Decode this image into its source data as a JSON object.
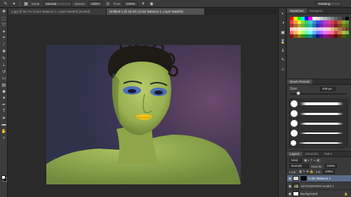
{
  "options_bar": {
    "mode_label": "Mode:",
    "mode_value": "Normal",
    "opacity_label": "Opacity:",
    "opacity_value": "100%",
    "flow_label": "Flow:",
    "flow_value": "100%",
    "workspace": "Painting"
  },
  "tabs": [
    {
      "label": "1.jpg @ 66.7% (Color Balance 1, Layer Mask/8) [scaled]",
      "active": false
    },
    {
      "label": "Untitled-1 @ 33.3% (Color Balance 1, Layer Mask/8)",
      "active": true
    }
  ],
  "swatches_panel": {
    "tabs": [
      "Swatches",
      "Navigator"
    ],
    "colors": [
      [
        "#ff0000",
        "#ffff00",
        "#00ff00",
        "#00ffff",
        "#0000ff",
        "#ff00ff",
        "#ffffff",
        "#e6e6e6",
        "#cccccc",
        "#b3b3b3",
        "#999999",
        "#808080",
        "#666666",
        "#4d4d4d",
        "#333333",
        "#000000"
      ],
      [
        "#ff3c3c",
        "#ff9f3c",
        "#f4f43c",
        "#7bdc3c",
        "#3ccc73",
        "#3ccfcf",
        "#3c8fdc",
        "#3c52d8",
        "#6f3cd4",
        "#b03cd0",
        "#d83ca0",
        "#d83c5a",
        "#a83232",
        "#a86a32",
        "#9e9e32",
        "#5a9e32"
      ],
      [
        "#b32d2d",
        "#b36b2d",
        "#b3a92d",
        "#6fb32d",
        "#2db36b",
        "#2db3b3",
        "#2d6fb3",
        "#2d2db3",
        "#6b2db3",
        "#a92db3",
        "#b32d8a",
        "#b32d4d",
        "#7a1f1f",
        "#7a4b1f",
        "#77741f",
        "#3f7a1f"
      ],
      [
        "#f7c6c6",
        "#f7dcc6",
        "#f7f3c6",
        "#dcf7c6",
        "#c6f7d8",
        "#c6f3f7",
        "#c6d8f7",
        "#cbc6f7",
        "#e2c6f7",
        "#f7c6ef",
        "#f7c6d6",
        "#e0b48c",
        "#c89868",
        "#a87848",
        "#886038",
        "#684828"
      ],
      [
        "#ff6f6f",
        "#ffb36f",
        "#ffee6f",
        "#a6ff6f",
        "#6fffa6",
        "#6fffff",
        "#6fb3ff",
        "#6f7aff",
        "#a66fff",
        "#ee6fff",
        "#ff6fc7",
        "#ff6f8f",
        "#c04848",
        "#c08048",
        "#bfb648",
        "#70c048"
      ],
      [
        "#8a1010",
        "#8a5010",
        "#8a8510",
        "#3a8a10",
        "#108a50",
        "#108a8a",
        "#10508a",
        "#10108a",
        "#50108a",
        "#85108a",
        "#8a1060",
        "#8a1030",
        "#5a0a0a",
        "#5a340a",
        "#57550a",
        "#255a0a"
      ]
    ]
  },
  "brush_panel": {
    "title": "Brush Presets",
    "size_label": "Size:",
    "size_value": "428 px"
  },
  "layers_panel": {
    "tabs": [
      "Layers",
      "Channels",
      "Paths"
    ],
    "filter_kind": "Kind",
    "blend_mode": "Normal",
    "opacity_label": "Opacity:",
    "opacity_value": "100%",
    "lock_label": "Lock:",
    "fill_label": "Fill:",
    "fill_value": "100%",
    "layers": [
      {
        "name": "Color Balance 1",
        "selected": true
      },
      {
        "name": "167104257643-model 1",
        "selected": false
      },
      {
        "name": "Background",
        "selected": false
      }
    ]
  }
}
